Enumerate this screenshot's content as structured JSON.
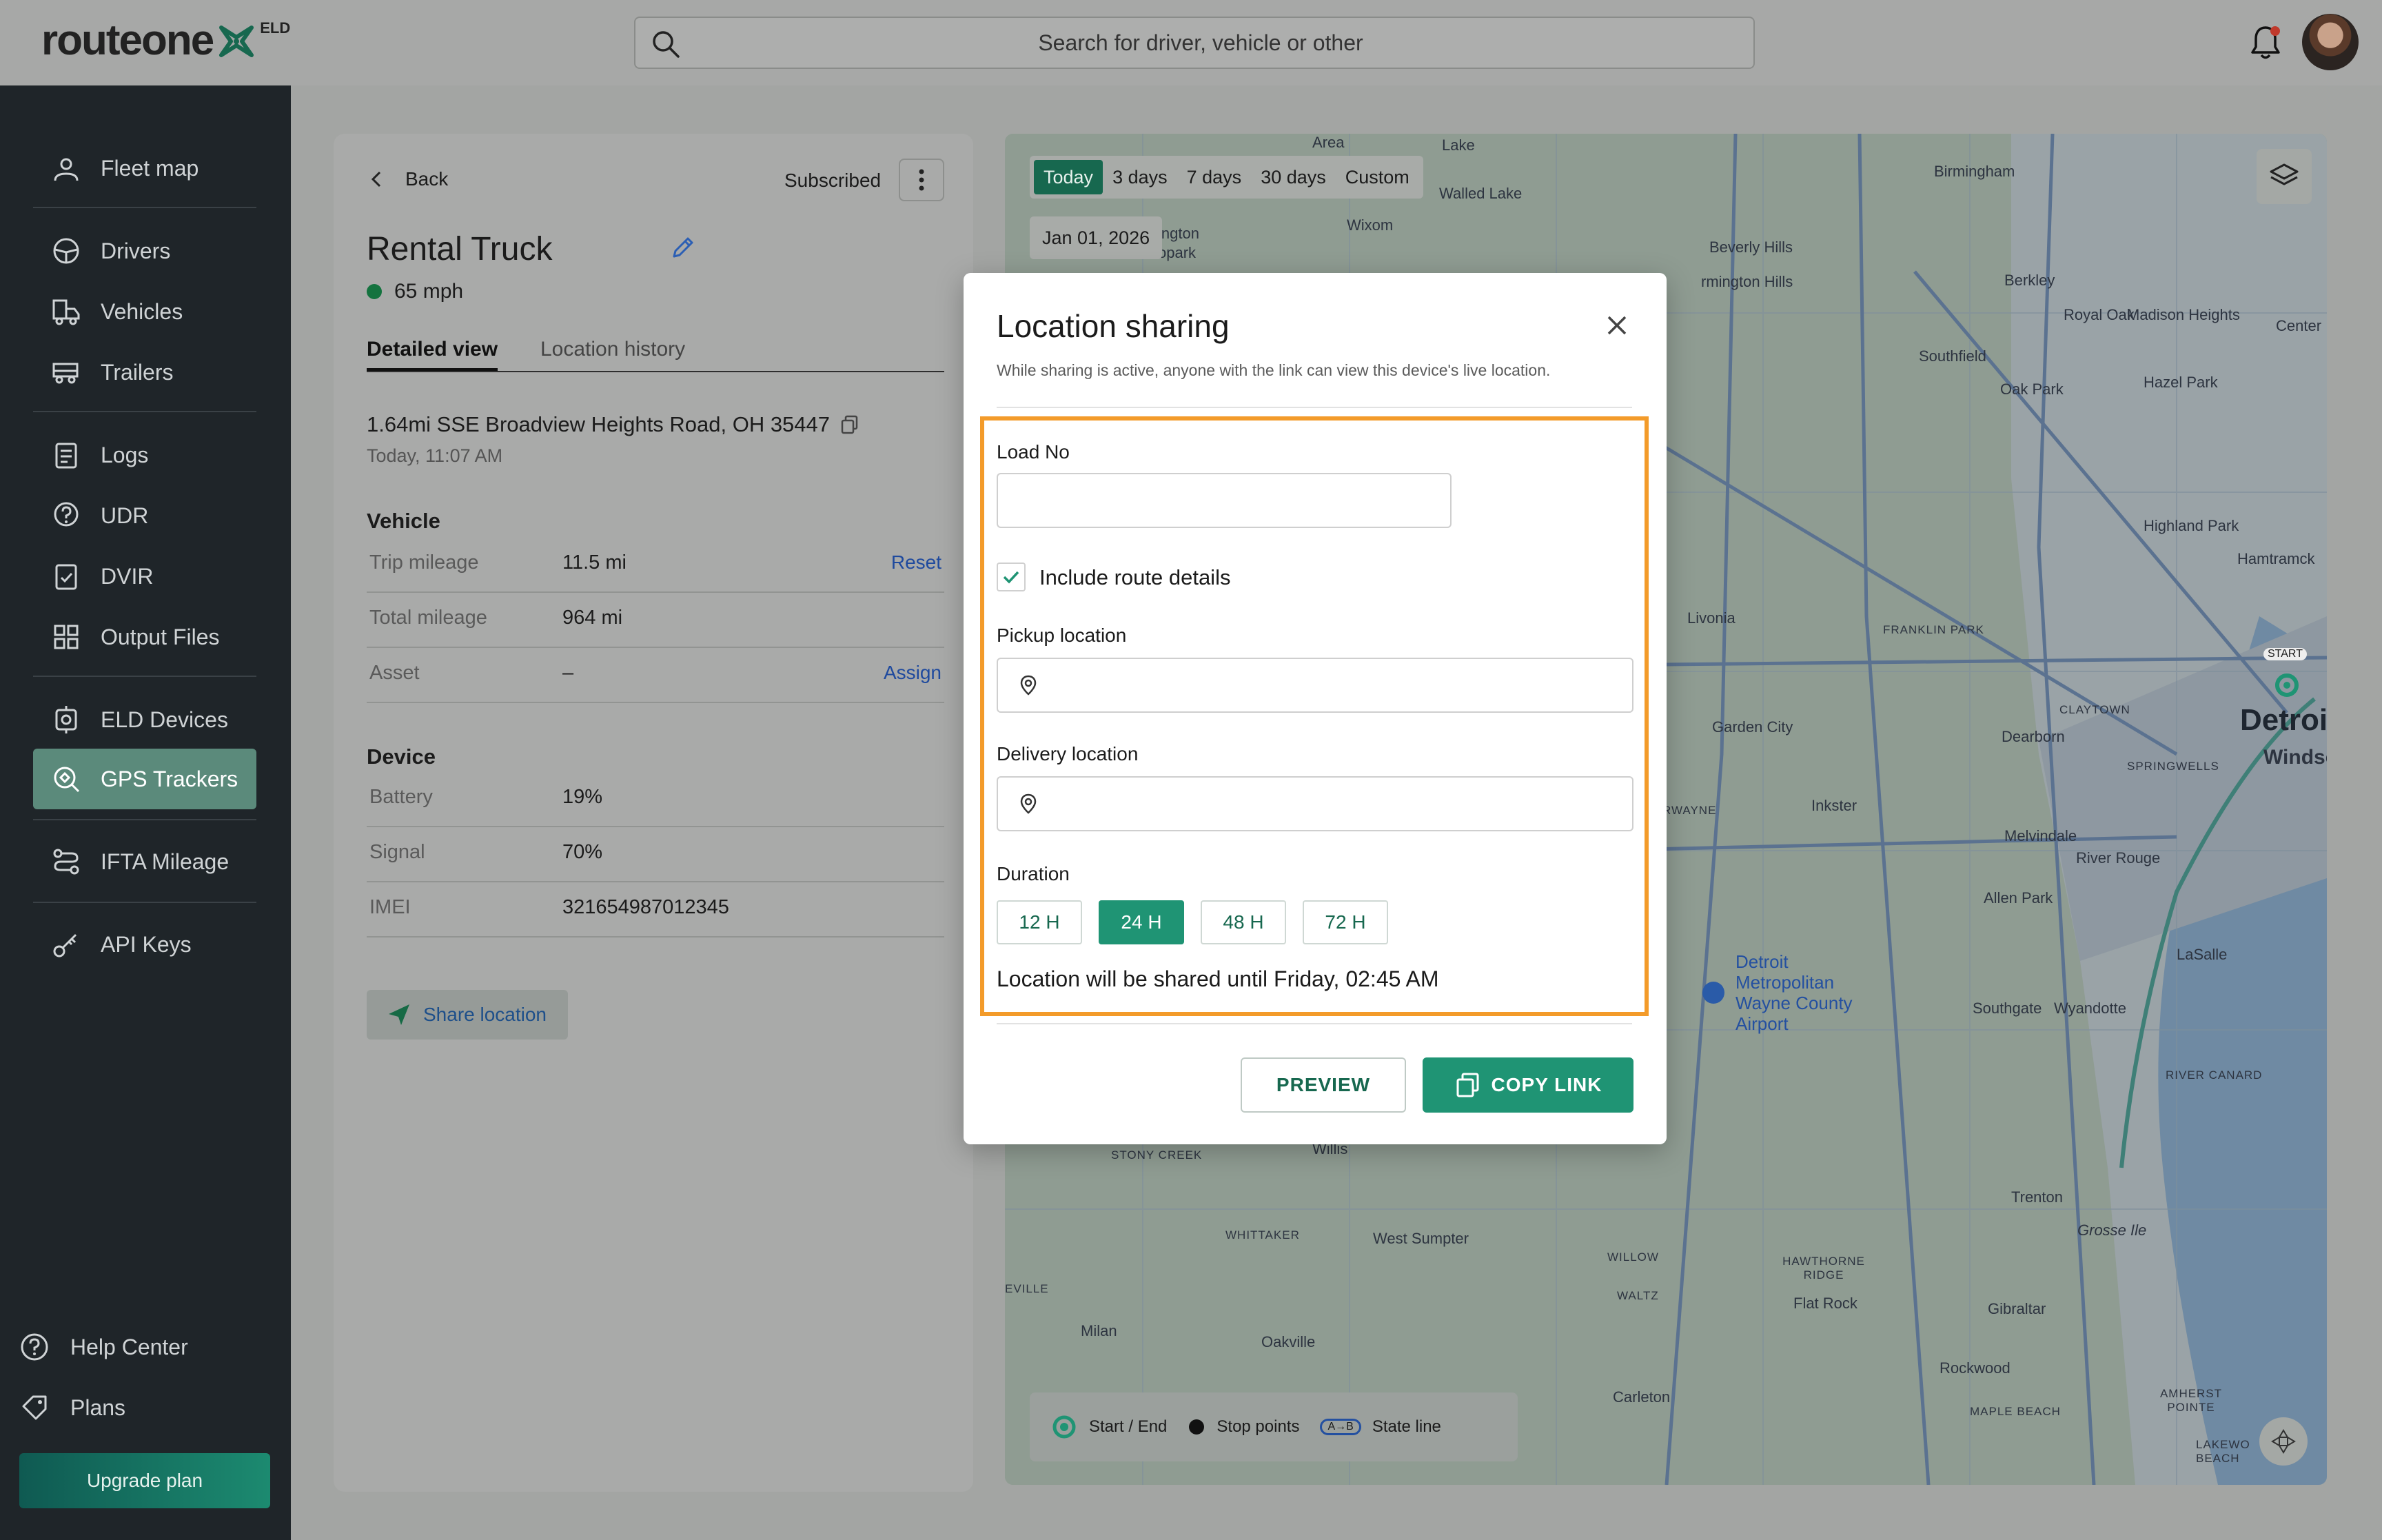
{
  "app": {
    "logo_text": "routeone",
    "logo_badge": "ELD",
    "search_placeholder": "Search for driver, vehicle or other"
  },
  "sidebar": {
    "items": [
      {
        "label": "Fleet map",
        "icon": "map-pin-icon"
      },
      {
        "label": "Drivers",
        "icon": "steering-wheel-icon"
      },
      {
        "label": "Vehicles",
        "icon": "truck-icon"
      },
      {
        "label": "Trailers",
        "icon": "trailer-icon"
      },
      {
        "label": "Logs",
        "icon": "clipboard-icon"
      },
      {
        "label": "UDR",
        "icon": "question-pin-icon"
      },
      {
        "label": "DVIR",
        "icon": "checklist-icon"
      },
      {
        "label": "Output Files",
        "icon": "grid-icon"
      },
      {
        "label": "ELD Devices",
        "icon": "device-icon"
      },
      {
        "label": "GPS Trackers",
        "icon": "gps-icon"
      },
      {
        "label": "IFTA Mileage",
        "icon": "route-icon"
      },
      {
        "label": "API Keys",
        "icon": "key-icon"
      }
    ],
    "active": "GPS Trackers",
    "help_label": "Help Center",
    "plans_label": "Plans",
    "upgrade_label": "Upgrade plan"
  },
  "detail": {
    "back_label": "Back",
    "status_label": "Subscribed",
    "title": "Rental Truck",
    "speed": "65 mph",
    "speed_color": "#14733f",
    "tabs": [
      "Detailed view",
      "Location history"
    ],
    "active_tab": "Detailed view",
    "address": "1.64mi SSE Broadview Heights Road, OH 35447",
    "address_time": "Today, 11:07 AM",
    "vehicle_title": "Vehicle",
    "vehicle_rows": [
      {
        "key": "Trip mileage",
        "value": "11.5 mi",
        "action": "Reset"
      },
      {
        "key": "Total mileage",
        "value": "964 mi",
        "action": ""
      },
      {
        "key": "Asset",
        "value": "–",
        "action": "Assign"
      }
    ],
    "device_title": "Device",
    "device_rows": [
      {
        "key": "Battery",
        "value": "19%"
      },
      {
        "key": "Signal",
        "value": "70%"
      },
      {
        "key": "IMEI",
        "value": "321654987012345"
      }
    ],
    "share_label": "Share location"
  },
  "map": {
    "ranges": [
      "Today",
      "3 days",
      "7 days",
      "30 days",
      "Custom"
    ],
    "active_range": "Today",
    "date": "Jan 01, 2026",
    "legend": {
      "start_end": "Start / End",
      "stop_points": "Stop points",
      "state_line": "State line",
      "state_line_badge": "A→B"
    },
    "start_badge": "START",
    "labels": {
      "area": "Area",
      "lake": "Lake",
      "walled_lake": "Walled Lake",
      "wixom": "Wixom",
      "birmingham": "Birmingham",
      "beverly_hills": "Beverly Hills",
      "berkley": "Berkley",
      "royal_oak": "Royal Oak",
      "madison_heights": "Madison Heights",
      "southfield": "Southfield",
      "oak_park": "Oak Park",
      "hazel_park": "Hazel Park",
      "center": "Center",
      "highland_park": "Highland Park",
      "hamtramck": "Hamtramck",
      "livonia": "Livonia",
      "franklin_park": "FRANKLIN PARK",
      "clayton": "CLAYTOWN",
      "detroit": "Detroi",
      "windsor": "Windsc",
      "garden_city": "Garden City",
      "dearborn": "Dearborn",
      "springwells": "SPRINGWELLS",
      "inkster": "Inkster",
      "wayne": "RWAYNE",
      "melvindale": "Melvindale",
      "river_rouge": "River Rouge",
      "allen_park": "Allen Park",
      "airport": "Detroit Metropolitan Wayne County Airport",
      "lasalle": "LaSalle",
      "southgate": "Southgate",
      "wyandotte": "Wyandotte",
      "river_canard": "RIVER CANARD",
      "trenton": "Trenton",
      "grosse_ile": "Grosse Ile",
      "stony_creek": "STONY CREEK",
      "willis": "Willis",
      "whittaker": "WHITTAKER",
      "west_sumpter": "West Sumpter",
      "willow": "WILLOW",
      "walz": "WALTZ",
      "hawthorne": "HAWTHORNE RIDGE",
      "flat_rock": "Flat Rock",
      "gibraltar": "Gibraltar",
      "eville": "EVILLE",
      "milan": "Milan",
      "oakville": "Oakville",
      "carleton": "Carleton",
      "rockwood": "Rockwood",
      "maple_beach": "MAPLE BEACH",
      "amherst": "AMHERST POINTE",
      "lakewood": "LAKEWO BEACH",
      "farmington": "rmington Hills",
      "lington": "ington",
      "park": "opark"
    }
  },
  "modal": {
    "title": "Location sharing",
    "subtitle": "While sharing is active, anyone with the link can view this device's live location.",
    "load_no_label": "Load No",
    "load_no_value": "",
    "include_route_label": "Include route details",
    "include_route_checked": true,
    "pickup_label": "Pickup location",
    "pickup_value": "",
    "delivery_label": "Delivery location",
    "delivery_value": "",
    "duration_label": "Duration",
    "durations": [
      "12 H",
      "24 H",
      "48 H",
      "72 H"
    ],
    "active_duration": "24 H",
    "until_text": "Location will be shared until Friday, 02:45 AM",
    "preview_label": "PREVIEW",
    "copy_label": "COPY LINK",
    "accent": "#1f9474",
    "highlight": "#f39b2a"
  }
}
